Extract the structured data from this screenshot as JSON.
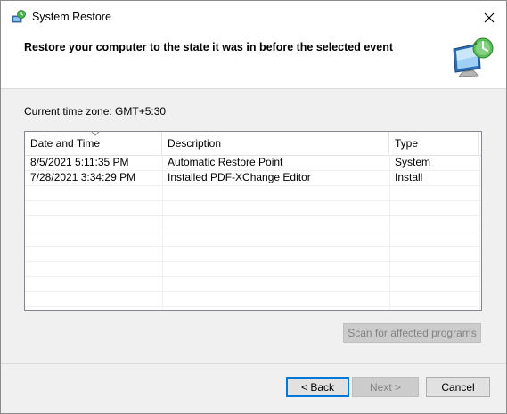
{
  "window": {
    "title": "System Restore"
  },
  "header": {
    "instruction": "Restore your computer to the state it was in before the selected event"
  },
  "timezone_label": "Current time zone: GMT+5:30",
  "table": {
    "columns": [
      "Date and Time",
      "Description",
      "Type"
    ],
    "sorted_column": "Date and Time",
    "rows": [
      {
        "date": "8/5/2021 5:11:35 PM",
        "description": "Automatic Restore Point",
        "type": "System"
      },
      {
        "date": "7/28/2021 3:34:29 PM",
        "description": "Installed PDF-XChange Editor",
        "type": "Install"
      }
    ]
  },
  "buttons": {
    "scan": "Scan for affected programs",
    "back": "< Back",
    "next": "Next >",
    "cancel": "Cancel"
  },
  "icons": {
    "title": "system-restore-icon",
    "header": "system-restore-monitor-icon",
    "close": "close-icon"
  }
}
